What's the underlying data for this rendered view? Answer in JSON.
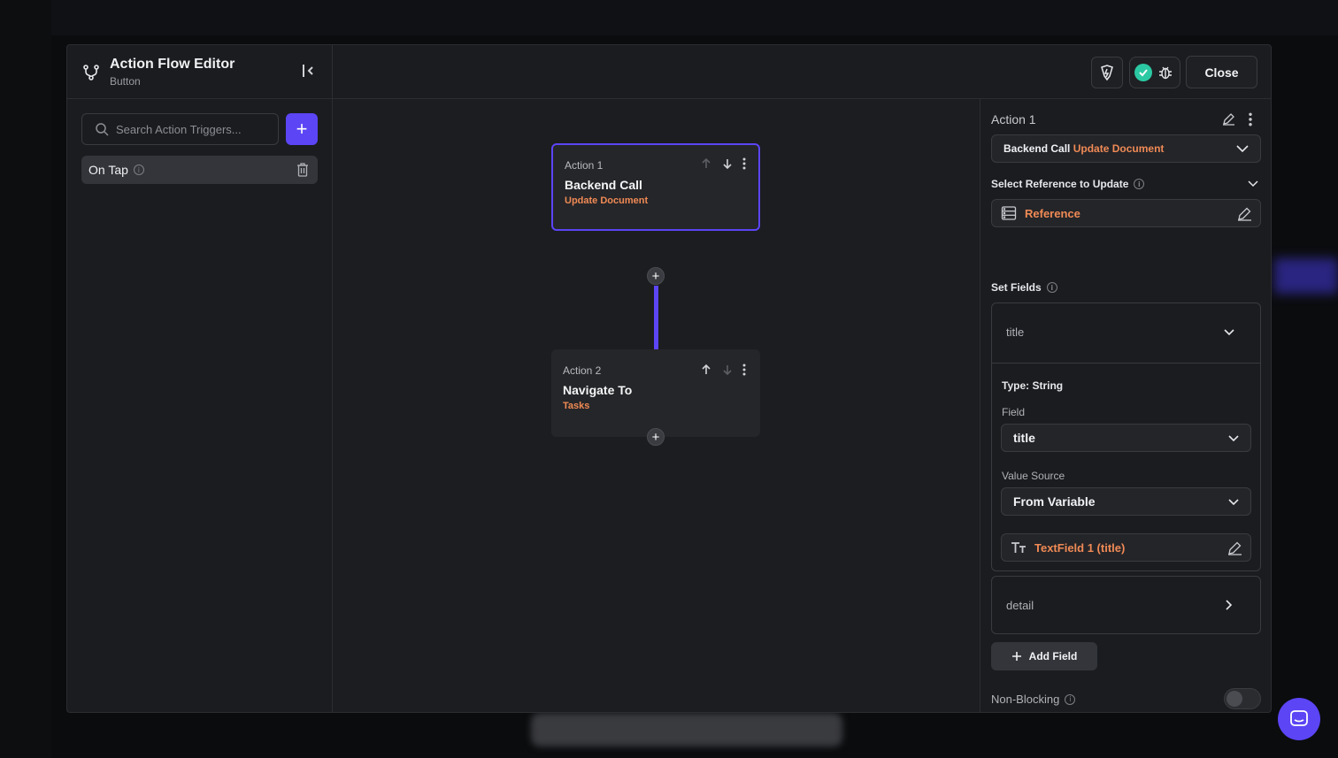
{
  "header": {
    "title": "Action Flow Editor",
    "subtitle": "Button"
  },
  "left_panel": {
    "search_placeholder": "Search Action Triggers...",
    "add_label": "+",
    "trigger_label": "On Tap",
    "info_glyph": "i"
  },
  "top_bar": {
    "close_label": "Close"
  },
  "canvas": {
    "actions": [
      {
        "label": "Action 1",
        "name": "Backend Call",
        "sub": "Update Document"
      },
      {
        "label": "Action 2",
        "name": "Navigate To",
        "sub": "Tasks"
      }
    ],
    "plus": "+"
  },
  "right_panel": {
    "title": "Action 1",
    "action_type": "Backend Call",
    "action_sub": "Update Document",
    "ref_label": "Select Reference to Update",
    "ref_value": "Reference",
    "set_fields_label": "Set Fields",
    "field1": {
      "name": "title",
      "type_label": "Type: String",
      "field_label": "Field",
      "field_value": "title",
      "value_source_label": "Value Source",
      "value_source": "From Variable",
      "variable": "TextField 1 (title)"
    },
    "field2_name": "detail",
    "add_field_label": "Add Field",
    "non_blocking_label": "Non-Blocking",
    "non_blocking_on": false
  },
  "colors": {
    "accent": "#5b45f5",
    "orange": "#f08a55",
    "success": "#2bc9a3"
  },
  "icons": [
    "flow-icon",
    "collapse-icon",
    "search-icon",
    "plus-icon",
    "info-icon",
    "trash-icon",
    "bolt-icon",
    "check-icon",
    "bug-icon",
    "arrow-up-icon",
    "arrow-down-icon",
    "more-icon",
    "edit-icon",
    "chevron-down-icon",
    "chevron-right-icon",
    "database-icon",
    "text-icon",
    "chat-icon"
  ]
}
